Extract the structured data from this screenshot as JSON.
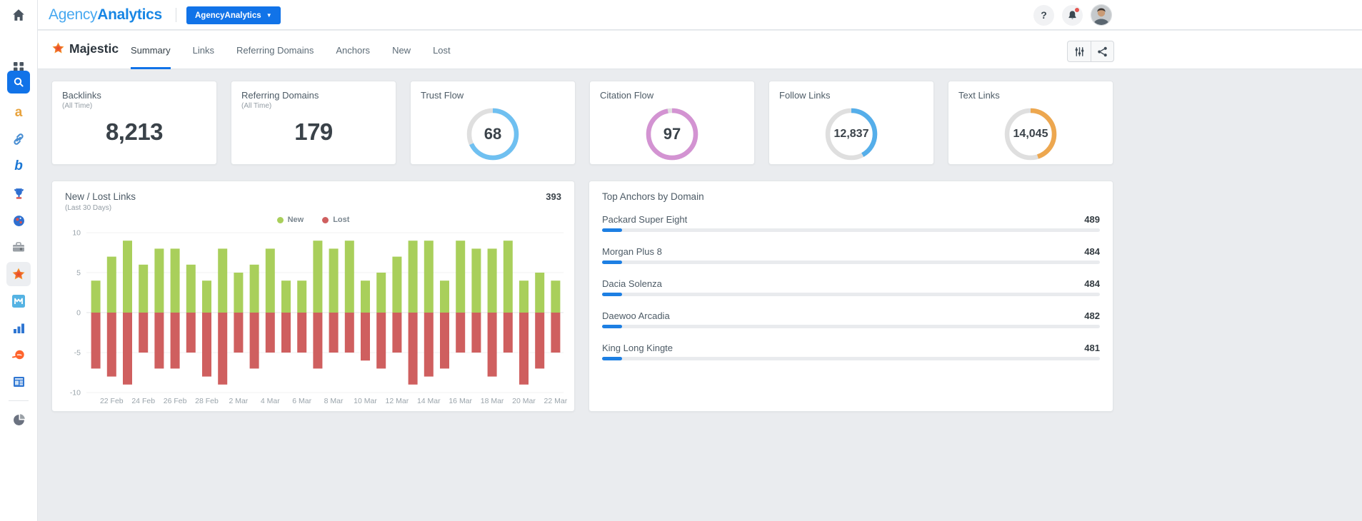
{
  "colors": {
    "accent_blue": "#1173e8",
    "bar_new": "#a9cf5b",
    "bar_lost": "#cf5f5f",
    "progress_blue": "#1d7fe3",
    "donut_track": "#dfdfdf"
  },
  "topbar": {
    "logo_light": "Agency",
    "logo_bold": "Analytics",
    "account_button_label": "AgencyAnalytics",
    "help_label": "?",
    "icons": [
      "home-icon",
      "help-icon",
      "notifications-bell-icon",
      "user-avatar"
    ]
  },
  "sidebar": {
    "icons": [
      "home",
      "apps-grid",
      "search",
      "alexa-a",
      "backlinks-chain",
      "bing",
      "rank-trophy",
      "web-globe",
      "toolbox",
      "majestic-star",
      "moz",
      "bar-chart",
      "semrush",
      "news",
      "pie-chart"
    ],
    "active": [
      "search",
      "majestic-star"
    ]
  },
  "subheader": {
    "title": "Majestic",
    "tabs": [
      {
        "label": "Summary",
        "active": true
      },
      {
        "label": "Links",
        "active": false
      },
      {
        "label": "Referring Domains",
        "active": false
      },
      {
        "label": "Anchors",
        "active": false
      },
      {
        "label": "New",
        "active": false
      },
      {
        "label": "Lost",
        "active": false
      }
    ],
    "actions": [
      "filter-sliders",
      "share"
    ]
  },
  "stat_cards": [
    {
      "title": "Backlinks",
      "subtitle": "(All Time)",
      "value": "8,213",
      "type": "number"
    },
    {
      "title": "Referring Domains",
      "subtitle": "(All Time)",
      "value": "179",
      "type": "number"
    },
    {
      "title": "Trust Flow",
      "subtitle": "",
      "value": "68",
      "type": "donut",
      "percent": 68,
      "color": "#6fc0f1"
    },
    {
      "title": "Citation Flow",
      "subtitle": "",
      "value": "97",
      "type": "donut",
      "percent": 97,
      "color": "#d393d2"
    },
    {
      "title": "Follow Links",
      "subtitle": "",
      "value": "12,837",
      "type": "donut",
      "percent": 42,
      "color": "#55aeea"
    },
    {
      "title": "Text Links",
      "subtitle": "",
      "value": "14,045",
      "type": "donut",
      "percent": 45,
      "color": "#eda74f"
    }
  ],
  "chart_data": {
    "type": "bar",
    "title": "New / Lost Links",
    "subtitle": "(Last 30 Days)",
    "total_label": "393",
    "ylim": [
      -10,
      10
    ],
    "yticks": [
      10,
      5,
      0,
      -5,
      -10
    ],
    "x_labels": [
      "22 Feb",
      "24 Feb",
      "26 Feb",
      "28 Feb",
      "2 Mar",
      "4 Mar",
      "6 Mar",
      "8 Mar",
      "10 Mar",
      "12 Mar",
      "14 Mar",
      "16 Mar",
      "18 Mar",
      "20 Mar",
      "22 Mar"
    ],
    "label_every": 2,
    "series": [
      {
        "name": "New",
        "color": "#a9cf5b",
        "values": [
          4,
          7,
          9,
          6,
          8,
          8,
          6,
          4,
          8,
          5,
          6,
          8,
          4,
          4,
          9,
          8,
          9,
          4,
          5,
          7,
          9,
          9,
          4,
          9,
          8,
          8,
          9,
          4,
          5,
          4
        ]
      },
      {
        "name": "Lost",
        "color": "#cf5f5f",
        "values": [
          -7,
          -8,
          -9,
          -5,
          -7,
          -7,
          -5,
          -8,
          -9,
          -5,
          -7,
          -5,
          -5,
          -5,
          -7,
          -5,
          -5,
          -6,
          -7,
          -5,
          -9,
          -8,
          -7,
          -5,
          -5,
          -8,
          -5,
          -9,
          -7,
          -5
        ]
      }
    ],
    "legend_position": "top-center",
    "grid": true
  },
  "top_anchors": {
    "title": "Top Anchors by Domain",
    "items": [
      {
        "label": "Packard Super Eight",
        "value": "489",
        "bar_fraction": 0.04
      },
      {
        "label": "Morgan Plus 8",
        "value": "484",
        "bar_fraction": 0.04
      },
      {
        "label": "Dacia Solenza",
        "value": "484",
        "bar_fraction": 0.04
      },
      {
        "label": "Daewoo Arcadia",
        "value": "482",
        "bar_fraction": 0.04
      },
      {
        "label": "King Long Kingte",
        "value": "481",
        "bar_fraction": 0.04
      }
    ]
  }
}
